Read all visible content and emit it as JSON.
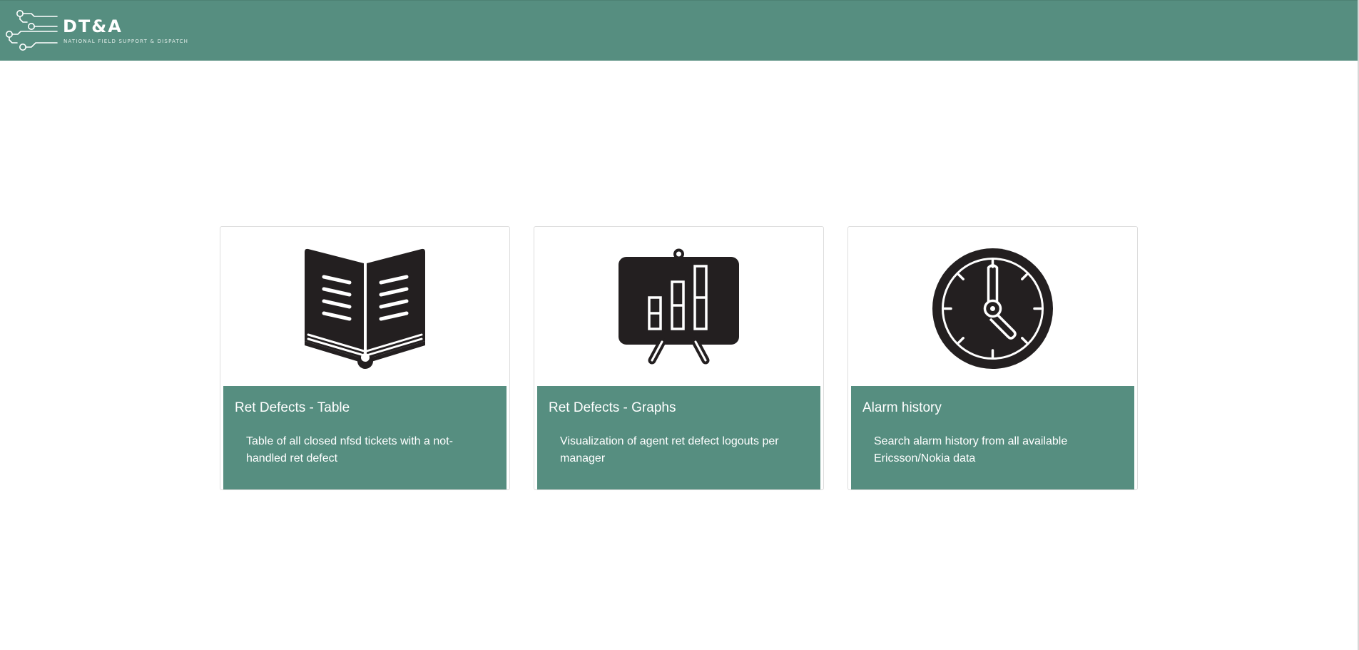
{
  "header": {
    "logo_title": "DT&A",
    "logo_subtitle": "NATIONAL FIELD SUPPORT & DISPATCH",
    "logo_icon": "circuit-traces-icon",
    "background_color": "#568e80"
  },
  "cards": [
    {
      "title": "Ret Defects - Table",
      "description": "Table of all closed nfsd tickets with a not-handled ret defect",
      "icon": "open-book-icon"
    },
    {
      "title": "Ret Defects - Graphs",
      "description": "Visualization of agent ret defect logouts per manager",
      "icon": "presentation-chart-icon"
    },
    {
      "title": "Alarm history",
      "description": "Search alarm history from all available Ericsson/Nokia data",
      "icon": "clock-icon"
    }
  ],
  "colors": {
    "accent": "#568e80",
    "icon": "#231f20",
    "text_on_accent": "#ffffff"
  }
}
